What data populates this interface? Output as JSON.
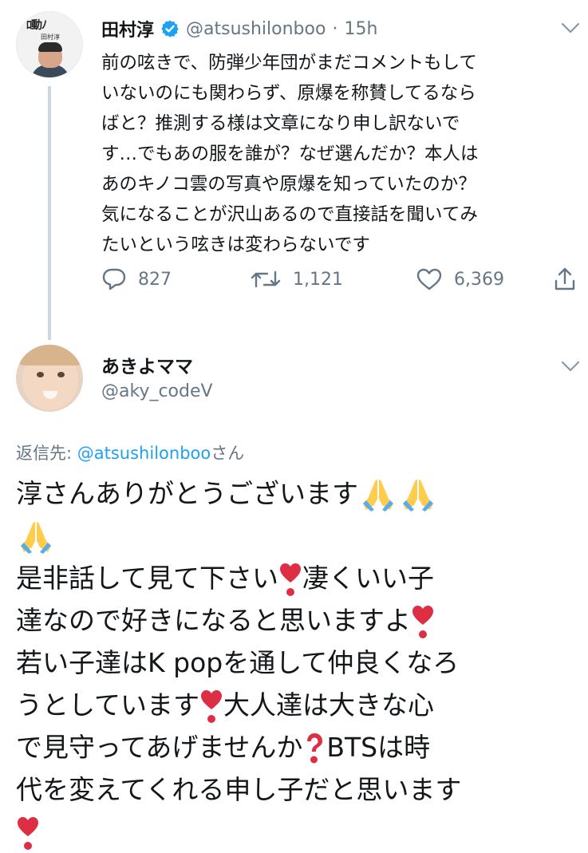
{
  "tweet1": {
    "author_name": "田村淳",
    "handle": "@atsushilonboo",
    "separator": "·",
    "time": "15h",
    "avatar_brand": "ﾛ動ﾉ",
    "avatar_small": "田村淳",
    "lines": [
      "前の呟きで、防弾少年団がまだコメントもして",
      "いないのにも関わらず、原爆を称賛してるなら",
      "ばと？推測する様は文章になり申し訳ないで",
      "す…でもあの服を誰が？なぜ選んだか？本人は",
      "あのキノコ雲の写真や原爆を知っていたのか？",
      "気になることが沢山あるので直接話を聞いてみ",
      "たいという呟きは変わらないです"
    ],
    "replies": "827",
    "retweets": "1,121",
    "likes": "6,369"
  },
  "tweet2": {
    "author_name": "あきよママ",
    "handle": "@aky_codeV",
    "reply_prefix": "返信先: ",
    "reply_mention": "@atsushilonboo",
    "reply_suffix": "さん",
    "line1": "淳さんありがとうございます",
    "line3a": "是非話して見て下さい",
    "line3b": "凄くいい子",
    "line4": "達なので好きになると思いますよ",
    "line5": "若い子達はK popを通して仲良くなろ",
    "line6a": "うとしています",
    "line6b": "大人達は大きな心",
    "line7a": "で見守ってあげませんか",
    "line7b": "BTSは時",
    "line8": "代を変えてくれる申し子だと思います"
  },
  "colors": {
    "accent": "#1da1f2",
    "muted": "#657786",
    "text": "#14171a",
    "thread_line": "#ccd6dd",
    "emoji_red": "#dd2e44",
    "emoji_hands": "#ffcc4d",
    "emoji_sleeve": "#55acee"
  },
  "icons": [
    "verified-badge-icon",
    "chevron-down-icon",
    "reply-icon",
    "retweet-icon",
    "like-icon",
    "share-icon",
    "folded-hands-emoji",
    "heart-exclamation-emoji",
    "red-question-emoji"
  ]
}
